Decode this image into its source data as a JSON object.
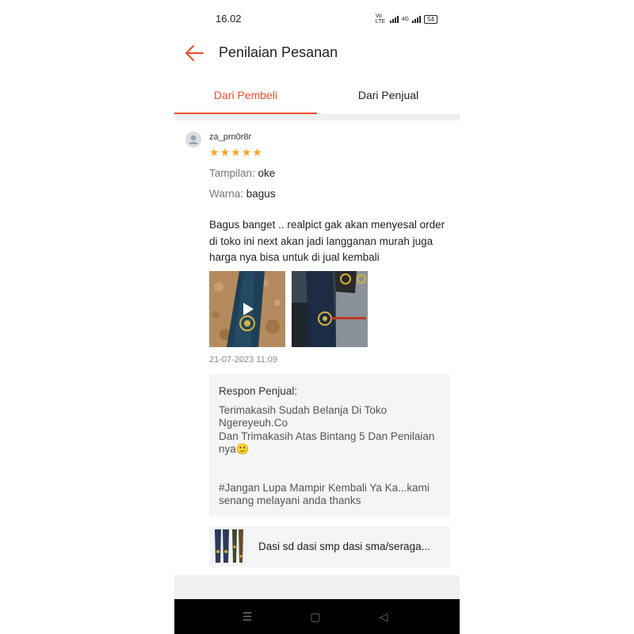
{
  "status_bar": {
    "time": "16.02",
    "network_1": "Vo LTE",
    "network_2": "4G",
    "battery": "54"
  },
  "header": {
    "title": "Penilaian Pesanan",
    "back_icon": "arrow-left-icon"
  },
  "tabs": [
    {
      "label": "Dari Pembeli",
      "active": true
    },
    {
      "label": "Dari Penjual",
      "active": false
    }
  ],
  "review": {
    "username": "za_prn0r8r",
    "rating": 5,
    "star_symbol": "★",
    "attributes": [
      {
        "key": "Tampilan:",
        "value": "oke"
      },
      {
        "key": "Warna:",
        "value": "bagus"
      }
    ],
    "comment": "Bagus banget .. realpict gak akan menyesal order di toko ini next akan jadi langganan murah juga harga nya bisa untuk di jual kembali",
    "media": [
      {
        "type": "video",
        "icon": "play-icon"
      },
      {
        "type": "image"
      }
    ],
    "date": "21-07-2023 11:09",
    "seller_response": {
      "label": "Respon Penjual:",
      "text": "Terimakasih Sudah Belanja Di Toko Ngereyeuh.Co\nDan Trimakasih Atas Bintang 5 Dan Penilaian nya🙂\n\n\n#Jangan Lupa Mampir Kembali Ya Ka...kami senang melayani anda thanks"
    },
    "product": {
      "name": "Dasi sd dasi smp dasi sma/seraga..."
    }
  },
  "nav_bar": {
    "recent_symbol": "☰",
    "home_symbol": "▢",
    "back_symbol": "◁"
  },
  "colors": {
    "accent": "#ee4d2d",
    "star": "#f5a623",
    "background": "#ffffff",
    "panel": "#f5f5f5"
  }
}
